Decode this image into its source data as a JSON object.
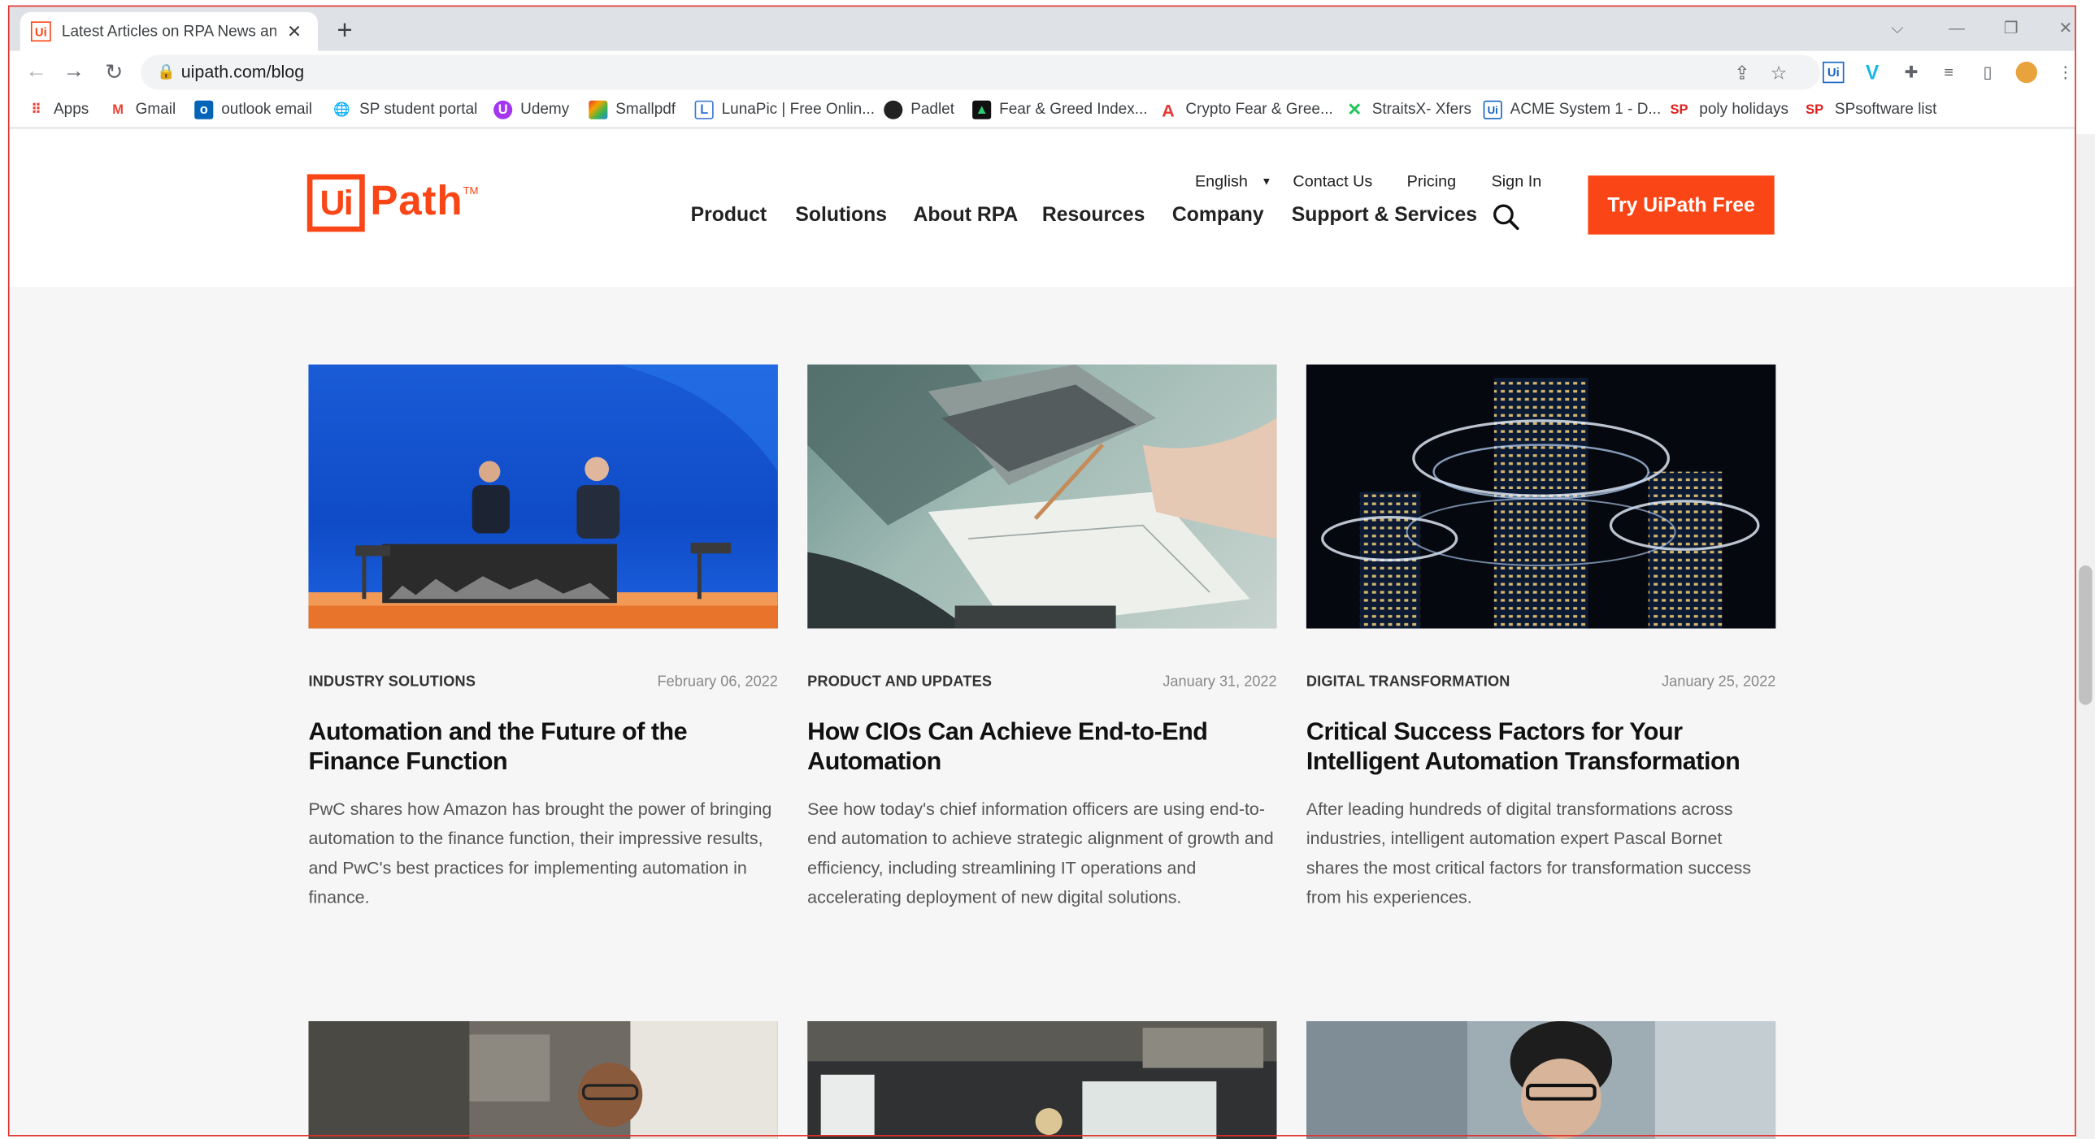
{
  "browser": {
    "tab_title": "Latest Articles on RPA News and",
    "tab_favicon": "Ui",
    "new_tab": "+",
    "url": "uipath.com/blog",
    "bookmarks": [
      {
        "label": "Apps",
        "icon": "apps-grid-icon",
        "color": "#4285f4"
      },
      {
        "label": "Gmail",
        "icon": "gmail-icon",
        "color": "#ea4335"
      },
      {
        "label": "outlook email",
        "icon": "outlook-icon",
        "color": "#0364b8"
      },
      {
        "label": "SP student portal",
        "icon": "globe-icon",
        "color": "#5f6368"
      },
      {
        "label": "Udemy",
        "icon": "udemy-icon",
        "color": "#a435f0"
      },
      {
        "label": "Smallpdf",
        "icon": "smallpdf-icon",
        "color": "#e5322d"
      },
      {
        "label": "LunaPic | Free Onlin...",
        "icon": "lunapic-icon",
        "color": "#3a7bd5"
      },
      {
        "label": "Padlet",
        "icon": "padlet-icon",
        "color": "#222222"
      },
      {
        "label": "Fear & Greed Index...",
        "icon": "cnn-icon",
        "color": "#0a7f3f"
      },
      {
        "label": "Crypto Fear & Gree...",
        "icon": "alternative-icon",
        "color": "#e53935"
      },
      {
        "label": "StraitsX- Xfers",
        "icon": "straitsx-icon",
        "color": "#22c55e"
      },
      {
        "label": "ACME System 1 - D...",
        "icon": "acme-icon",
        "color": "#1565c0"
      },
      {
        "label": "poly holidays",
        "icon": "sp-icon",
        "color": "#e02020"
      },
      {
        "label": "SPsoftware list",
        "icon": "sp-icon",
        "color": "#e02020"
      }
    ]
  },
  "header": {
    "logo_ui": "Ui",
    "logo_path": "Path",
    "logo_tm": "TM",
    "language": "English",
    "utility_links": [
      "Contact Us",
      "Pricing",
      "Sign In"
    ],
    "nav": [
      "Product",
      "Solutions",
      "About RPA",
      "Resources",
      "Company",
      "Support & Services"
    ],
    "cta": "Try UiPath Free",
    "accent": "#fa4616"
  },
  "articles": [
    {
      "category": "INDUSTRY SOLUTIONS",
      "date": "February 06, 2022",
      "title": "Automation and the Future of the Finance Function",
      "description": "PwC shares how Amazon has brought the power of bringing automation to the finance function, their impressive results, and PwC's best practices for implementing automation in finance."
    },
    {
      "category": "PRODUCT AND UPDATES",
      "date": "January 31, 2022",
      "title": "How CIOs Can Achieve End-to-End Automation",
      "description": "See how today's chief information officers are using end-to-end automation to achieve strategic alignment of growth and efficiency, including streamlining IT operations and accelerating deployment of new digital solutions."
    },
    {
      "category": "DIGITAL TRANSFORMATION",
      "date": "January 25, 2022",
      "title": "Critical Success Factors for Your Intelligent Automation Transformation",
      "description": "After leading hundreds of digital transformations across industries, intelligent automation expert Pascal Bornet shares the most critical factors for transformation success from his experiences."
    }
  ]
}
